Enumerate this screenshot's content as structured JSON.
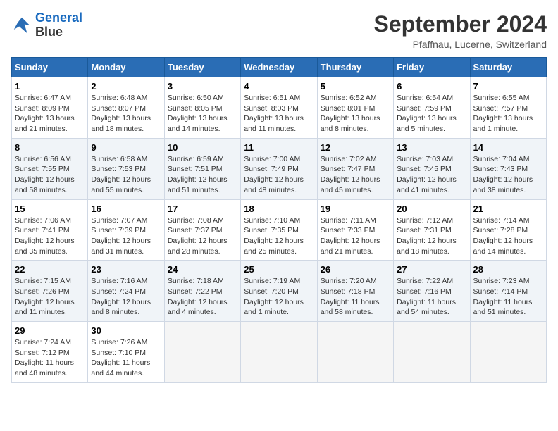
{
  "header": {
    "logo_line1": "General",
    "logo_line2": "Blue",
    "month": "September 2024",
    "location": "Pfaffnau, Lucerne, Switzerland"
  },
  "days_of_week": [
    "Sunday",
    "Monday",
    "Tuesday",
    "Wednesday",
    "Thursday",
    "Friday",
    "Saturday"
  ],
  "weeks": [
    [
      {
        "day": "1",
        "sunrise": "Sunrise: 6:47 AM",
        "sunset": "Sunset: 8:09 PM",
        "daylight": "Daylight: 13 hours and 21 minutes."
      },
      {
        "day": "2",
        "sunrise": "Sunrise: 6:48 AM",
        "sunset": "Sunset: 8:07 PM",
        "daylight": "Daylight: 13 hours and 18 minutes."
      },
      {
        "day": "3",
        "sunrise": "Sunrise: 6:50 AM",
        "sunset": "Sunset: 8:05 PM",
        "daylight": "Daylight: 13 hours and 14 minutes."
      },
      {
        "day": "4",
        "sunrise": "Sunrise: 6:51 AM",
        "sunset": "Sunset: 8:03 PM",
        "daylight": "Daylight: 13 hours and 11 minutes."
      },
      {
        "day": "5",
        "sunrise": "Sunrise: 6:52 AM",
        "sunset": "Sunset: 8:01 PM",
        "daylight": "Daylight: 13 hours and 8 minutes."
      },
      {
        "day": "6",
        "sunrise": "Sunrise: 6:54 AM",
        "sunset": "Sunset: 7:59 PM",
        "daylight": "Daylight: 13 hours and 5 minutes."
      },
      {
        "day": "7",
        "sunrise": "Sunrise: 6:55 AM",
        "sunset": "Sunset: 7:57 PM",
        "daylight": "Daylight: 13 hours and 1 minute."
      }
    ],
    [
      {
        "day": "8",
        "sunrise": "Sunrise: 6:56 AM",
        "sunset": "Sunset: 7:55 PM",
        "daylight": "Daylight: 12 hours and 58 minutes."
      },
      {
        "day": "9",
        "sunrise": "Sunrise: 6:58 AM",
        "sunset": "Sunset: 7:53 PM",
        "daylight": "Daylight: 12 hours and 55 minutes."
      },
      {
        "day": "10",
        "sunrise": "Sunrise: 6:59 AM",
        "sunset": "Sunset: 7:51 PM",
        "daylight": "Daylight: 12 hours and 51 minutes."
      },
      {
        "day": "11",
        "sunrise": "Sunrise: 7:00 AM",
        "sunset": "Sunset: 7:49 PM",
        "daylight": "Daylight: 12 hours and 48 minutes."
      },
      {
        "day": "12",
        "sunrise": "Sunrise: 7:02 AM",
        "sunset": "Sunset: 7:47 PM",
        "daylight": "Daylight: 12 hours and 45 minutes."
      },
      {
        "day": "13",
        "sunrise": "Sunrise: 7:03 AM",
        "sunset": "Sunset: 7:45 PM",
        "daylight": "Daylight: 12 hours and 41 minutes."
      },
      {
        "day": "14",
        "sunrise": "Sunrise: 7:04 AM",
        "sunset": "Sunset: 7:43 PM",
        "daylight": "Daylight: 12 hours and 38 minutes."
      }
    ],
    [
      {
        "day": "15",
        "sunrise": "Sunrise: 7:06 AM",
        "sunset": "Sunset: 7:41 PM",
        "daylight": "Daylight: 12 hours and 35 minutes."
      },
      {
        "day": "16",
        "sunrise": "Sunrise: 7:07 AM",
        "sunset": "Sunset: 7:39 PM",
        "daylight": "Daylight: 12 hours and 31 minutes."
      },
      {
        "day": "17",
        "sunrise": "Sunrise: 7:08 AM",
        "sunset": "Sunset: 7:37 PM",
        "daylight": "Daylight: 12 hours and 28 minutes."
      },
      {
        "day": "18",
        "sunrise": "Sunrise: 7:10 AM",
        "sunset": "Sunset: 7:35 PM",
        "daylight": "Daylight: 12 hours and 25 minutes."
      },
      {
        "day": "19",
        "sunrise": "Sunrise: 7:11 AM",
        "sunset": "Sunset: 7:33 PM",
        "daylight": "Daylight: 12 hours and 21 minutes."
      },
      {
        "day": "20",
        "sunrise": "Sunrise: 7:12 AM",
        "sunset": "Sunset: 7:31 PM",
        "daylight": "Daylight: 12 hours and 18 minutes."
      },
      {
        "day": "21",
        "sunrise": "Sunrise: 7:14 AM",
        "sunset": "Sunset: 7:28 PM",
        "daylight": "Daylight: 12 hours and 14 minutes."
      }
    ],
    [
      {
        "day": "22",
        "sunrise": "Sunrise: 7:15 AM",
        "sunset": "Sunset: 7:26 PM",
        "daylight": "Daylight: 12 hours and 11 minutes."
      },
      {
        "day": "23",
        "sunrise": "Sunrise: 7:16 AM",
        "sunset": "Sunset: 7:24 PM",
        "daylight": "Daylight: 12 hours and 8 minutes."
      },
      {
        "day": "24",
        "sunrise": "Sunrise: 7:18 AM",
        "sunset": "Sunset: 7:22 PM",
        "daylight": "Daylight: 12 hours and 4 minutes."
      },
      {
        "day": "25",
        "sunrise": "Sunrise: 7:19 AM",
        "sunset": "Sunset: 7:20 PM",
        "daylight": "Daylight: 12 hours and 1 minute."
      },
      {
        "day": "26",
        "sunrise": "Sunrise: 7:20 AM",
        "sunset": "Sunset: 7:18 PM",
        "daylight": "Daylight: 11 hours and 58 minutes."
      },
      {
        "day": "27",
        "sunrise": "Sunrise: 7:22 AM",
        "sunset": "Sunset: 7:16 PM",
        "daylight": "Daylight: 11 hours and 54 minutes."
      },
      {
        "day": "28",
        "sunrise": "Sunrise: 7:23 AM",
        "sunset": "Sunset: 7:14 PM",
        "daylight": "Daylight: 11 hours and 51 minutes."
      }
    ],
    [
      {
        "day": "29",
        "sunrise": "Sunrise: 7:24 AM",
        "sunset": "Sunset: 7:12 PM",
        "daylight": "Daylight: 11 hours and 48 minutes."
      },
      {
        "day": "30",
        "sunrise": "Sunrise: 7:26 AM",
        "sunset": "Sunset: 7:10 PM",
        "daylight": "Daylight: 11 hours and 44 minutes."
      },
      null,
      null,
      null,
      null,
      null
    ]
  ]
}
